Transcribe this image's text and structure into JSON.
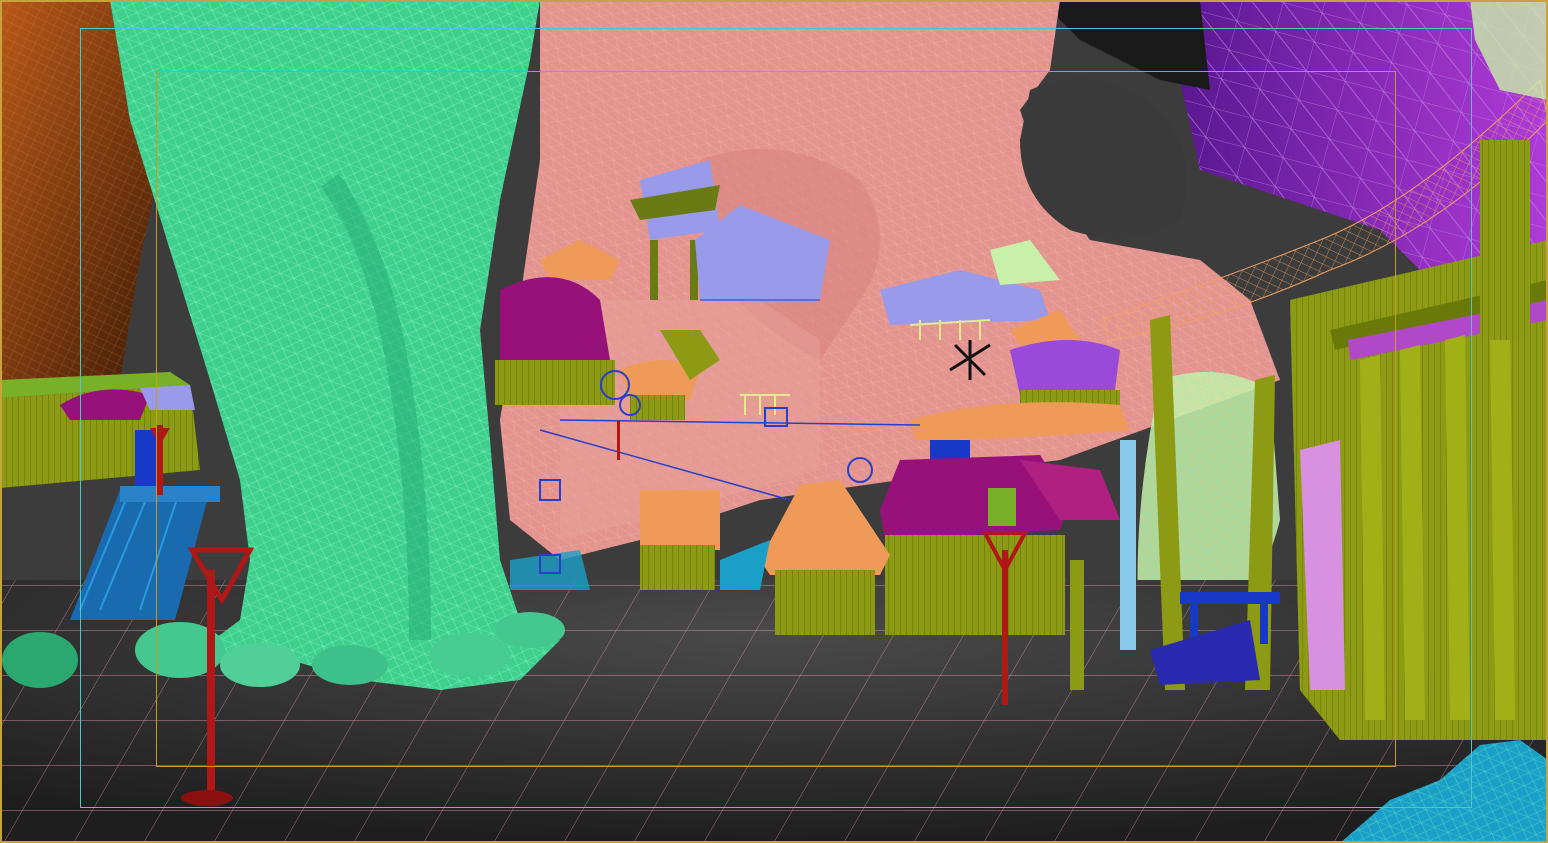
{
  "viewport": {
    "render_mode": "wireframe-shaded",
    "colors": {
      "background": "#3a3a3a",
      "ground": "#2b2b2b",
      "ground_wire": "#e89aa8",
      "cliff_pink": "#e4948e",
      "tree_green": "#3ed08c",
      "tree_wire": "#7ff0c0",
      "left_cliff_orange": "#8a4414",
      "right_cliff_purple": "#8a24b8",
      "house_olive": "#8c9a14",
      "roof_lavender": "#9a9aea",
      "roof_magenta": "#96127a",
      "roof_orange": "#f09a5a",
      "stilt_blue": "#1838c8",
      "marker_red": "#b01818",
      "rock_cyan": "#1aa0c8",
      "light_green": "#c8f0a8",
      "safe_frame_outer": "#4fc6c8",
      "safe_frame_inner": "#c79a2a"
    },
    "icons": {
      "camera_marker": "camera-gizmo-icon",
      "light_marker": "light-gizmo-icon",
      "helper_marker": "point-helper-icon"
    }
  }
}
